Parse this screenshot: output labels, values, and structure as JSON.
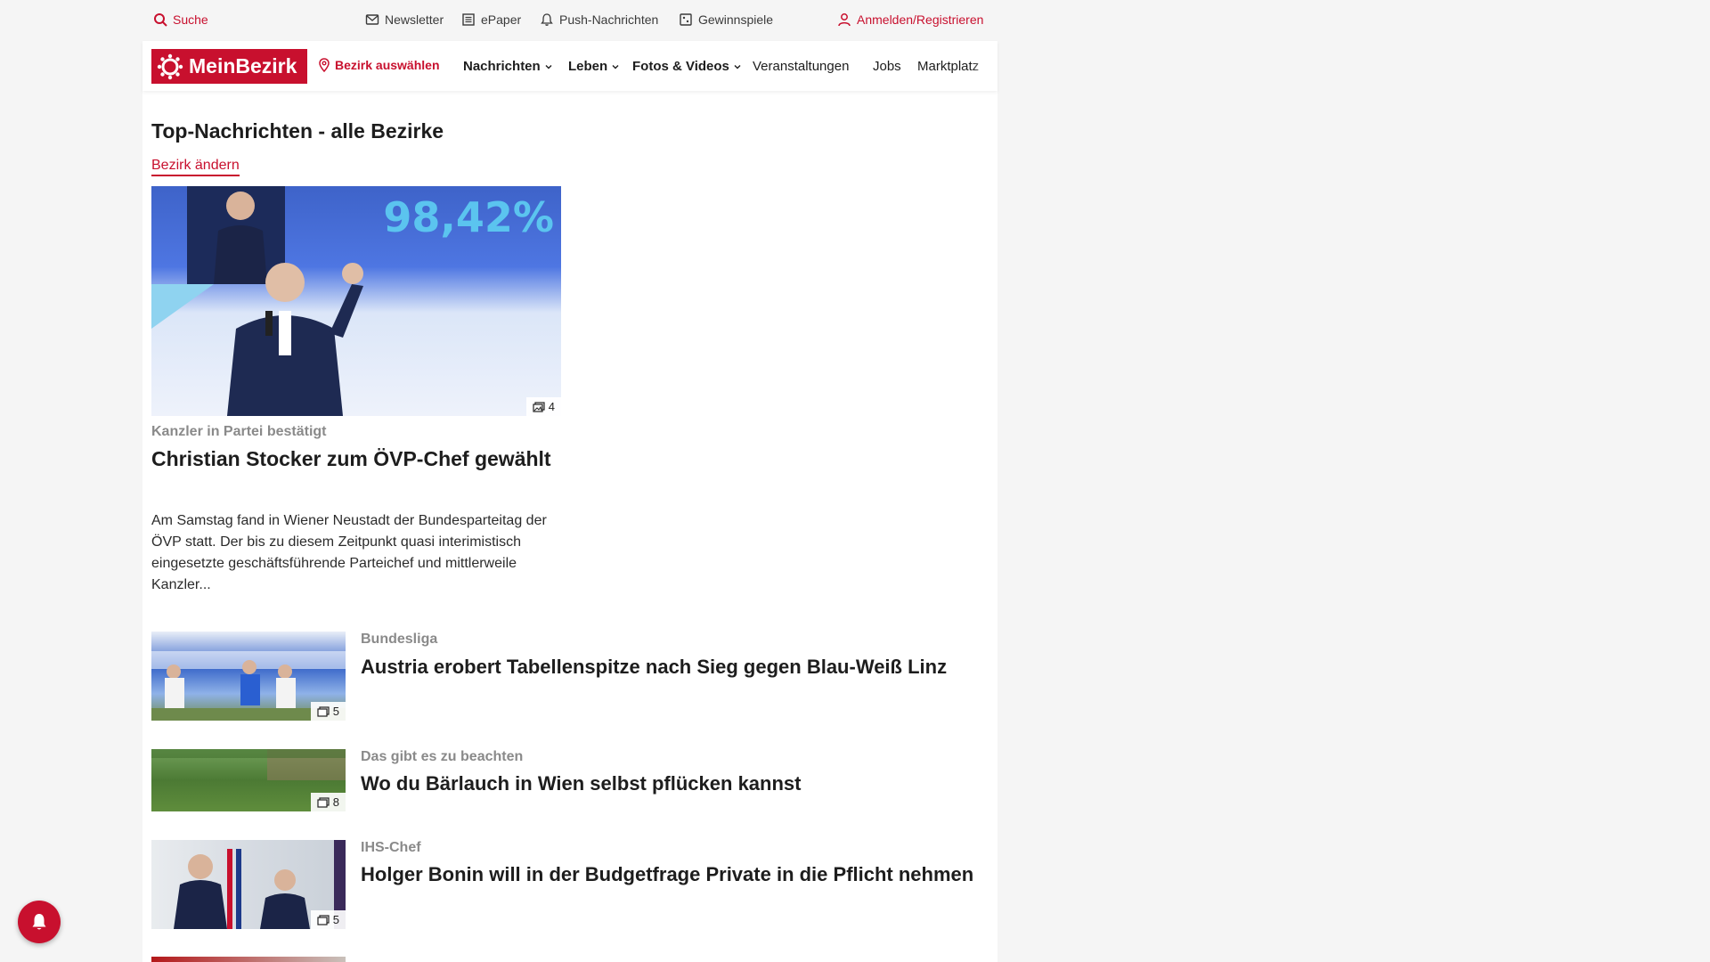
{
  "utility": {
    "search": "Suche",
    "newsletter": "Newsletter",
    "epaper": "ePaper",
    "push": "Push-Nachrichten",
    "contests": "Gewinnspiele",
    "login": "Anmelden/Registrieren"
  },
  "nav": {
    "logo": "MeinBezirk",
    "district": "Bezirk auswählen",
    "items": [
      "Nachrichten",
      "Leben",
      "Fotos & Videos",
      "Veranstaltungen",
      "Jobs",
      "Marktplatz"
    ]
  },
  "section": {
    "title": "Top-Nachrichten - alle Bezirke",
    "change": "Bezirk ändern"
  },
  "hero": {
    "image_text": "98,42%",
    "photo_count": "4",
    "kicker": "Kanzler in Partei bestätigt",
    "title": "Christian Stocker zum ÖVP-Chef gewählt",
    "teaser": "Am Samstag fand in Wiener Neustadt der Bundesparteitag der ÖVP statt. Der bis zu diesem Zeitpunkt quasi interimistisch eingesetzte geschäftsführende Parteichef und mittlerweile Kanzler..."
  },
  "articles": [
    {
      "kicker": "Bundesliga",
      "title": "Austria erobert Tabellenspitze nach Sieg gegen Blau-Weiß Linz",
      "photos": "5"
    },
    {
      "kicker": "Das gibt es zu beachten",
      "title": "Wo du Bärlauch in Wien selbst pflücken kannst",
      "photos": "8"
    },
    {
      "kicker": "IHS-Chef",
      "title": "Holger Bonin will in der Budgetfrage Private in die Pflicht nehmen",
      "photos": "5"
    }
  ],
  "colors": {
    "brand": "#c8102e",
    "kicker": "#8a8a8a"
  }
}
